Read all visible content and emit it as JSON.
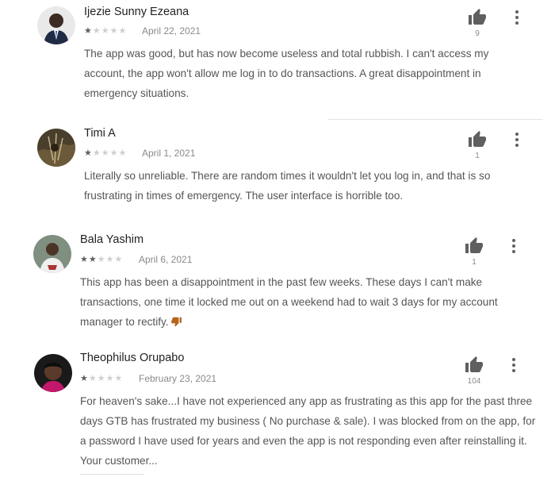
{
  "reviews": [
    {
      "name": "Ijezie Sunny Ezeana",
      "rating": 1,
      "date": "April 22, 2021",
      "likes": "9",
      "text": "The app was good, but has now become useless and total rubbish. I can't access my account, the app won't allow me log in to do transactions. A great disappointment in emergency situations."
    },
    {
      "name": "Timi A",
      "rating": 1,
      "date": "April 1, 2021",
      "likes": "1",
      "text": "Literally so unreliable. There are random times it wouldn't let you log in, and that is so frustrating in times of emergency. The user interface is horrible too."
    },
    {
      "name": "Bala Yashim",
      "rating": 2,
      "date": "April 6, 2021",
      "likes": "1",
      "text": "This app has been a disappointment in the past few weeks. These days I can't make transactions, one time it locked me out on a weekend had to wait 3 days for my account manager to rectify."
    },
    {
      "name": "Theophilus Orupabo",
      "rating": 1,
      "date": "February 23, 2021",
      "likes": "104",
      "text": "For heaven's sake...I have not experienced any app as frustrating as this app for the past three days GTB has frustrated my business ( No purchase & sale). I was blocked from on the app, for a password I have used for years and even the app is not responding even after reinstalling it. Your customer..."
    }
  ],
  "icons": {
    "like": "thumb-up-icon",
    "more": "more-vert-icon",
    "star": "star-icon",
    "emoji": "thumbs-down-emoji"
  },
  "colors": {
    "icon": "#5f5f5f",
    "star_on": "#5f5f5f",
    "star_off": "#cfcfcf",
    "text": "#555555"
  }
}
